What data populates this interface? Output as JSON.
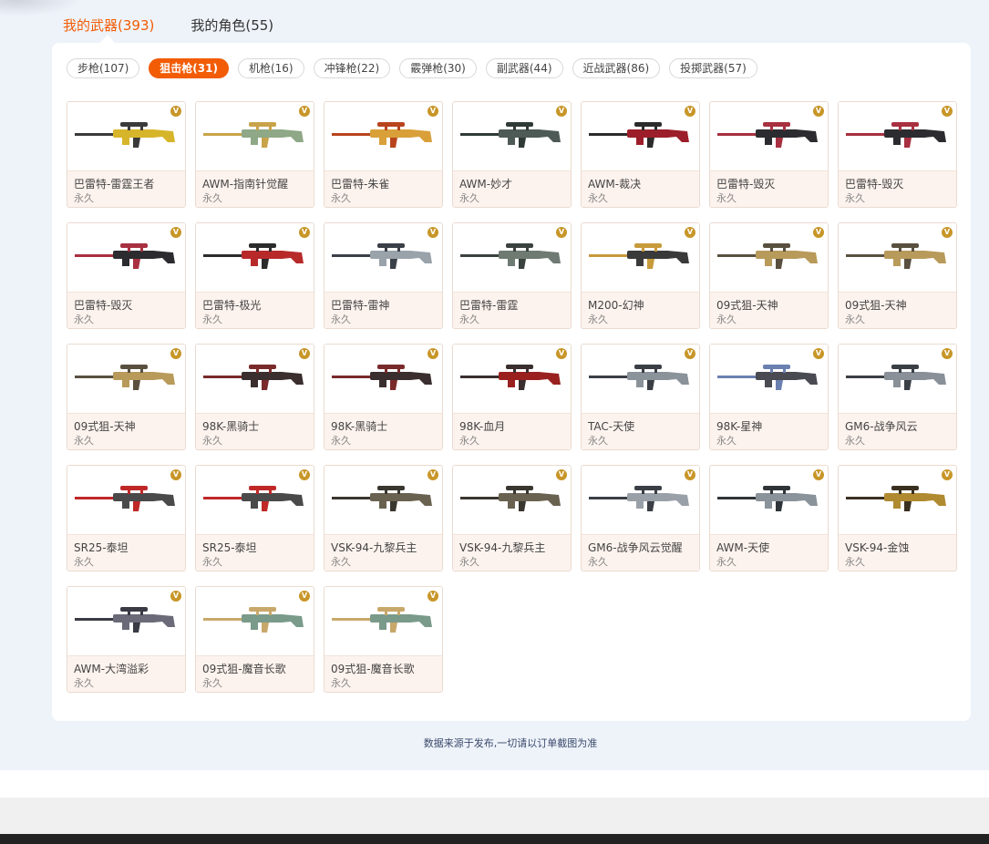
{
  "tabs": {
    "weapons": "我的武器(393)",
    "roles": "我的角色(55)"
  },
  "filters": [
    {
      "label": "步枪(107)",
      "active": false
    },
    {
      "label": "狙击枪(31)",
      "active": true
    },
    {
      "label": "机枪(16)",
      "active": false
    },
    {
      "label": "冲锋枪(22)",
      "active": false
    },
    {
      "label": "霰弹枪(30)",
      "active": false
    },
    {
      "label": "副武器(44)",
      "active": false
    },
    {
      "label": "近战武器(86)",
      "active": false
    },
    {
      "label": "投掷武器(57)",
      "active": false
    }
  ],
  "badge_text": "V",
  "items": [
    {
      "name": "巴雷特-雷霆王者",
      "term": "永久",
      "color": "#d7b52a",
      "accent": "#3a3a3a"
    },
    {
      "name": "AWM-指南针觉醒",
      "term": "永久",
      "color": "#8fa887",
      "accent": "#c9a34a"
    },
    {
      "name": "巴雷特-朱雀",
      "term": "永久",
      "color": "#d9a03a",
      "accent": "#b8441e"
    },
    {
      "name": "AWM-妙才",
      "term": "永久",
      "color": "#4d5a55",
      "accent": "#2f3a36"
    },
    {
      "name": "AWM-裁决",
      "term": "永久",
      "color": "#9c1e2a",
      "accent": "#2b2b2b"
    },
    {
      "name": "巴雷特-毁灭",
      "term": "永久",
      "color": "#2c2c30",
      "accent": "#a83040"
    },
    {
      "name": "巴雷特-毁灭",
      "term": "永久",
      "color": "#2c2c30",
      "accent": "#a83040"
    },
    {
      "name": "巴雷特-毁灭",
      "term": "永久",
      "color": "#2c2c30",
      "accent": "#a83040"
    },
    {
      "name": "巴雷特-极光",
      "term": "永久",
      "color": "#b82a2a",
      "accent": "#2b2b2b"
    },
    {
      "name": "巴雷特-雷神",
      "term": "永久",
      "color": "#9aa2aa",
      "accent": "#3b4048"
    },
    {
      "name": "巴雷特-雷霆",
      "term": "永久",
      "color": "#6e7a72",
      "accent": "#3a423e"
    },
    {
      "name": "M200-幻神",
      "term": "永久",
      "color": "#3a3a3a",
      "accent": "#c79a3a"
    },
    {
      "name": "09式狙-天神",
      "term": "永久",
      "color": "#b89a5a",
      "accent": "#5a5040"
    },
    {
      "name": "09式狙-天神",
      "term": "永久",
      "color": "#b89a5a",
      "accent": "#5a5040"
    },
    {
      "name": "09式狙-天神",
      "term": "永久",
      "color": "#b89a5a",
      "accent": "#5a5040"
    },
    {
      "name": "98K-黑骑士",
      "term": "永久",
      "color": "#3a2e2e",
      "accent": "#7a2a2a"
    },
    {
      "name": "98K-黑骑士",
      "term": "永久",
      "color": "#3a2e2e",
      "accent": "#7a2a2a"
    },
    {
      "name": "98K-血月",
      "term": "永久",
      "color": "#9a2020",
      "accent": "#3a2e2e"
    },
    {
      "name": "TAC-天使",
      "term": "永久",
      "color": "#8a929a",
      "accent": "#3a3f45"
    },
    {
      "name": "98K-星神",
      "term": "永久",
      "color": "#4a4a52",
      "accent": "#6a80b0"
    },
    {
      "name": "GM6-战争风云",
      "term": "永久",
      "color": "#8a9098",
      "accent": "#3a3f45"
    },
    {
      "name": "SR25-泰坦",
      "term": "永久",
      "color": "#4a4a4a",
      "accent": "#c02828"
    },
    {
      "name": "SR25-泰坦",
      "term": "永久",
      "color": "#4a4a4a",
      "accent": "#c02828"
    },
    {
      "name": "VSK-94-九黎兵主",
      "term": "永久",
      "color": "#6a6250",
      "accent": "#3a3630"
    },
    {
      "name": "VSK-94-九黎兵主",
      "term": "永久",
      "color": "#6a6250",
      "accent": "#3a3630"
    },
    {
      "name": "GM6-战争风云觉醒",
      "term": "永久",
      "color": "#9aa0a8",
      "accent": "#3a3f45"
    },
    {
      "name": "AWM-天使",
      "term": "永久",
      "color": "#8a929a",
      "accent": "#2f3438"
    },
    {
      "name": "VSK-94-金蚀",
      "term": "永久",
      "color": "#b08a30",
      "accent": "#3a3020"
    },
    {
      "name": "AWM-大湾溢彩",
      "term": "永久",
      "color": "#6a6a78",
      "accent": "#3a3a44"
    },
    {
      "name": "09式狙-魔音长歌",
      "term": "永久",
      "color": "#7a9a8a",
      "accent": "#c8a86a"
    },
    {
      "name": "09式狙-魔音长歌",
      "term": "永久",
      "color": "#7a9a8a",
      "accent": "#c8a86a"
    }
  ],
  "footnote": "数据来源于发布,一切请以订单截图为准"
}
